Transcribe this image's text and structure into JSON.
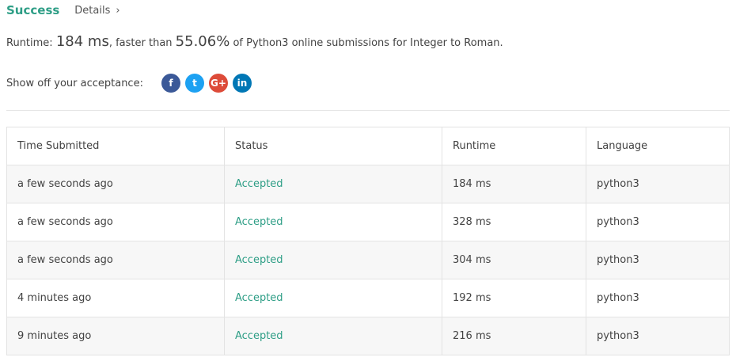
{
  "header": {
    "status": "Success",
    "details_label": "Details",
    "chevron": "›"
  },
  "summary": {
    "runtime_prefix": "Runtime:",
    "runtime_value": "184 ms",
    "faster_text": ", faster than",
    "percent": "55.06%",
    "suffix": "of Python3 online submissions for Integer to Roman."
  },
  "share": {
    "label": "Show off your acceptance:",
    "icons": [
      {
        "name": "facebook-icon",
        "glyph": "f",
        "color": "#3b5998"
      },
      {
        "name": "twitter-icon",
        "glyph": "t",
        "color": "#1da1f2"
      },
      {
        "name": "google-plus-icon",
        "glyph": "G+",
        "color": "#dd4b39"
      },
      {
        "name": "linkedin-icon",
        "glyph": "in",
        "color": "#0077b5"
      }
    ]
  },
  "table": {
    "headers": [
      "Time Submitted",
      "Status",
      "Runtime",
      "Language"
    ],
    "rows": [
      {
        "time": "a few seconds ago",
        "status": "Accepted",
        "runtime": "184 ms",
        "language": "python3"
      },
      {
        "time": "a few seconds ago",
        "status": "Accepted",
        "runtime": "328 ms",
        "language": "python3"
      },
      {
        "time": "a few seconds ago",
        "status": "Accepted",
        "runtime": "304 ms",
        "language": "python3"
      },
      {
        "time": "4 minutes ago",
        "status": "Accepted",
        "runtime": "192 ms",
        "language": "python3"
      },
      {
        "time": "9 minutes ago",
        "status": "Accepted",
        "runtime": "216 ms",
        "language": "python3"
      }
    ]
  },
  "colors": {
    "accent": "#2e9e86",
    "text": "#424242"
  }
}
